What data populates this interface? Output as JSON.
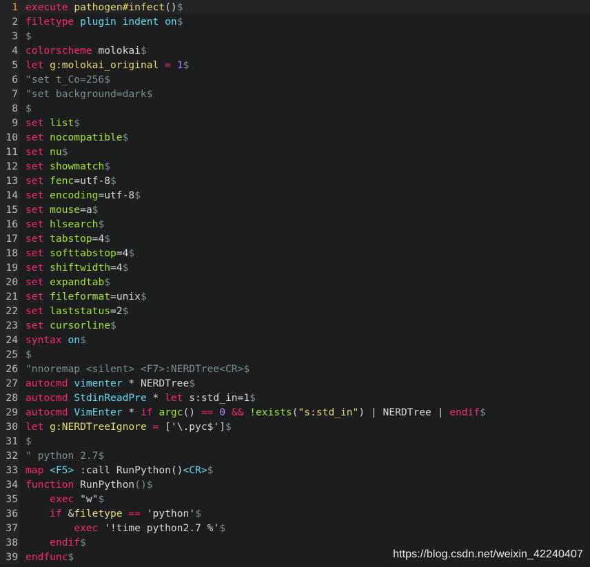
{
  "editor": {
    "current_line": 1,
    "lines": [
      {
        "n": 1,
        "tokens": [
          {
            "t": "execute",
            "c": "stmt"
          },
          {
            "t": " ",
            "c": "plain"
          },
          {
            "t": "pathogen#infect",
            "c": "str"
          },
          {
            "t": "()",
            "c": "plain"
          },
          {
            "t": "$",
            "c": "eol"
          }
        ]
      },
      {
        "n": 2,
        "tokens": [
          {
            "t": "filetype",
            "c": "stmt"
          },
          {
            "t": " ",
            "c": "plain"
          },
          {
            "t": "plugin",
            "c": "type"
          },
          {
            "t": " ",
            "c": "plain"
          },
          {
            "t": "indent",
            "c": "type"
          },
          {
            "t": " ",
            "c": "plain"
          },
          {
            "t": "on",
            "c": "type"
          },
          {
            "t": "$",
            "c": "eol"
          }
        ]
      },
      {
        "n": 3,
        "tokens": [
          {
            "t": "$",
            "c": "eol"
          }
        ]
      },
      {
        "n": 4,
        "tokens": [
          {
            "t": "colorscheme",
            "c": "stmt"
          },
          {
            "t": " molokai",
            "c": "plain"
          },
          {
            "t": "$",
            "c": "eol"
          }
        ]
      },
      {
        "n": 5,
        "tokens": [
          {
            "t": "let",
            "c": "stmt"
          },
          {
            "t": " ",
            "c": "plain"
          },
          {
            "t": "g:molokai_original",
            "c": "str"
          },
          {
            "t": " ",
            "c": "plain"
          },
          {
            "t": "=",
            "c": "op"
          },
          {
            "t": " ",
            "c": "plain"
          },
          {
            "t": "1",
            "c": "num"
          },
          {
            "t": "$",
            "c": "eol"
          }
        ]
      },
      {
        "n": 6,
        "tokens": [
          {
            "t": "\"set t_Co=256",
            "c": "cmt"
          },
          {
            "t": "$",
            "c": "eol"
          }
        ]
      },
      {
        "n": 7,
        "tokens": [
          {
            "t": "\"set background=dark",
            "c": "cmt"
          },
          {
            "t": "$",
            "c": "eol"
          }
        ]
      },
      {
        "n": 8,
        "tokens": [
          {
            "t": "$",
            "c": "eol"
          }
        ]
      },
      {
        "n": 9,
        "tokens": [
          {
            "t": "set",
            "c": "stmt"
          },
          {
            "t": " ",
            "c": "plain"
          },
          {
            "t": "list",
            "c": "fn"
          },
          {
            "t": "$",
            "c": "eol"
          }
        ]
      },
      {
        "n": 10,
        "tokens": [
          {
            "t": "set",
            "c": "stmt"
          },
          {
            "t": " ",
            "c": "plain"
          },
          {
            "t": "nocompatible",
            "c": "fn"
          },
          {
            "t": "$",
            "c": "eol"
          }
        ]
      },
      {
        "n": 11,
        "tokens": [
          {
            "t": "set",
            "c": "stmt"
          },
          {
            "t": " ",
            "c": "plain"
          },
          {
            "t": "nu",
            "c": "fn"
          },
          {
            "t": "$",
            "c": "eol"
          }
        ]
      },
      {
        "n": 12,
        "tokens": [
          {
            "t": "set",
            "c": "stmt"
          },
          {
            "t": " ",
            "c": "plain"
          },
          {
            "t": "showmatch",
            "c": "fn"
          },
          {
            "t": "$",
            "c": "eol"
          }
        ]
      },
      {
        "n": 13,
        "tokens": [
          {
            "t": "set",
            "c": "stmt"
          },
          {
            "t": " ",
            "c": "plain"
          },
          {
            "t": "fenc",
            "c": "fn"
          },
          {
            "t": "=utf-8",
            "c": "plain"
          },
          {
            "t": "$",
            "c": "eol"
          }
        ]
      },
      {
        "n": 14,
        "tokens": [
          {
            "t": "set",
            "c": "stmt"
          },
          {
            "t": " ",
            "c": "plain"
          },
          {
            "t": "encoding",
            "c": "fn"
          },
          {
            "t": "=utf-8",
            "c": "plain"
          },
          {
            "t": "$",
            "c": "eol"
          }
        ]
      },
      {
        "n": 15,
        "tokens": [
          {
            "t": "set",
            "c": "stmt"
          },
          {
            "t": " ",
            "c": "plain"
          },
          {
            "t": "mouse",
            "c": "fn"
          },
          {
            "t": "=a",
            "c": "plain"
          },
          {
            "t": "$",
            "c": "eol"
          }
        ]
      },
      {
        "n": 16,
        "tokens": [
          {
            "t": "set",
            "c": "stmt"
          },
          {
            "t": " ",
            "c": "plain"
          },
          {
            "t": "hlsearch",
            "c": "fn"
          },
          {
            "t": "$",
            "c": "eol"
          }
        ]
      },
      {
        "n": 17,
        "tokens": [
          {
            "t": "set",
            "c": "stmt"
          },
          {
            "t": " ",
            "c": "plain"
          },
          {
            "t": "tabstop",
            "c": "fn"
          },
          {
            "t": "=4",
            "c": "plain"
          },
          {
            "t": "$",
            "c": "eol"
          }
        ]
      },
      {
        "n": 18,
        "tokens": [
          {
            "t": "set",
            "c": "stmt"
          },
          {
            "t": " ",
            "c": "plain"
          },
          {
            "t": "softtabstop",
            "c": "fn"
          },
          {
            "t": "=4",
            "c": "plain"
          },
          {
            "t": "$",
            "c": "eol"
          }
        ]
      },
      {
        "n": 19,
        "tokens": [
          {
            "t": "set",
            "c": "stmt"
          },
          {
            "t": " ",
            "c": "plain"
          },
          {
            "t": "shiftwidth",
            "c": "fn"
          },
          {
            "t": "=4",
            "c": "plain"
          },
          {
            "t": "$",
            "c": "eol"
          }
        ]
      },
      {
        "n": 20,
        "tokens": [
          {
            "t": "set",
            "c": "stmt"
          },
          {
            "t": " ",
            "c": "plain"
          },
          {
            "t": "expandtab",
            "c": "fn"
          },
          {
            "t": "$",
            "c": "eol"
          }
        ]
      },
      {
        "n": 21,
        "tokens": [
          {
            "t": "set",
            "c": "stmt"
          },
          {
            "t": " ",
            "c": "plain"
          },
          {
            "t": "fileformat",
            "c": "fn"
          },
          {
            "t": "=unix",
            "c": "plain"
          },
          {
            "t": "$",
            "c": "eol"
          }
        ]
      },
      {
        "n": 22,
        "tokens": [
          {
            "t": "set",
            "c": "stmt"
          },
          {
            "t": " ",
            "c": "plain"
          },
          {
            "t": "laststatus",
            "c": "fn"
          },
          {
            "t": "=2",
            "c": "plain"
          },
          {
            "t": "$",
            "c": "eol"
          }
        ]
      },
      {
        "n": 23,
        "tokens": [
          {
            "t": "set",
            "c": "stmt"
          },
          {
            "t": " ",
            "c": "plain"
          },
          {
            "t": "cursorline",
            "c": "fn"
          },
          {
            "t": "$",
            "c": "eol"
          }
        ]
      },
      {
        "n": 24,
        "tokens": [
          {
            "t": "syntax",
            "c": "stmt"
          },
          {
            "t": " ",
            "c": "plain"
          },
          {
            "t": "on",
            "c": "type"
          },
          {
            "t": "$",
            "c": "eol"
          }
        ]
      },
      {
        "n": 25,
        "tokens": [
          {
            "t": "$",
            "c": "eol"
          }
        ]
      },
      {
        "n": 26,
        "tokens": [
          {
            "t": "\"nnoremap <silent> <F7>:NERDTree<CR>",
            "c": "cmt"
          },
          {
            "t": "$",
            "c": "eol"
          }
        ]
      },
      {
        "n": 27,
        "tokens": [
          {
            "t": "autocmd",
            "c": "stmt"
          },
          {
            "t": " ",
            "c": "plain"
          },
          {
            "t": "vimenter",
            "c": "type"
          },
          {
            "t": " * NERDTree",
            "c": "plain"
          },
          {
            "t": "$",
            "c": "eol"
          }
        ]
      },
      {
        "n": 28,
        "tokens": [
          {
            "t": "autocmd",
            "c": "stmt"
          },
          {
            "t": " ",
            "c": "plain"
          },
          {
            "t": "StdinReadPre",
            "c": "type"
          },
          {
            "t": " * ",
            "c": "plain"
          },
          {
            "t": "let",
            "c": "stmt"
          },
          {
            "t": " s:std_in=1",
            "c": "plain"
          },
          {
            "t": "$",
            "c": "eol"
          }
        ]
      },
      {
        "n": 29,
        "tokens": [
          {
            "t": "autocmd",
            "c": "stmt"
          },
          {
            "t": " ",
            "c": "plain"
          },
          {
            "t": "VimEnter",
            "c": "type"
          },
          {
            "t": " * ",
            "c": "plain"
          },
          {
            "t": "if",
            "c": "stmt"
          },
          {
            "t": " ",
            "c": "plain"
          },
          {
            "t": "argc",
            "c": "fn"
          },
          {
            "t": "() ",
            "c": "plain"
          },
          {
            "t": "==",
            "c": "op"
          },
          {
            "t": " ",
            "c": "plain"
          },
          {
            "t": "0",
            "c": "num"
          },
          {
            "t": " ",
            "c": "plain"
          },
          {
            "t": "&&",
            "c": "op"
          },
          {
            "t": " ",
            "c": "plain"
          },
          {
            "t": "!exists",
            "c": "fn"
          },
          {
            "t": "(",
            "c": "plain"
          },
          {
            "t": "\"s:std_in\"",
            "c": "str"
          },
          {
            "t": ") | NERDTree | ",
            "c": "plain"
          },
          {
            "t": "endif",
            "c": "stmt"
          },
          {
            "t": "$",
            "c": "eol"
          }
        ]
      },
      {
        "n": 30,
        "tokens": [
          {
            "t": "let",
            "c": "stmt"
          },
          {
            "t": " ",
            "c": "plain"
          },
          {
            "t": "g:NERDTreeIgnore",
            "c": "str"
          },
          {
            "t": " ",
            "c": "plain"
          },
          {
            "t": "=",
            "c": "op"
          },
          {
            "t": " ['\\.pyc$']",
            "c": "plain"
          },
          {
            "t": "$",
            "c": "eol"
          }
        ]
      },
      {
        "n": 31,
        "tokens": [
          {
            "t": "$",
            "c": "eol"
          }
        ]
      },
      {
        "n": 32,
        "tokens": [
          {
            "t": "\" python 2.7",
            "c": "cmt"
          },
          {
            "t": "$",
            "c": "eol"
          }
        ]
      },
      {
        "n": 33,
        "tokens": [
          {
            "t": "map",
            "c": "stmt"
          },
          {
            "t": " ",
            "c": "plain"
          },
          {
            "t": "<F5>",
            "c": "spec"
          },
          {
            "t": " :call RunPython()",
            "c": "plain"
          },
          {
            "t": "<CR>",
            "c": "spec"
          },
          {
            "t": "$",
            "c": "eol"
          }
        ]
      },
      {
        "n": 34,
        "tokens": [
          {
            "t": "function",
            "c": "stmt"
          },
          {
            "t": " RunPython",
            "c": "plain"
          },
          {
            "t": "()",
            "c": "eol"
          },
          {
            "t": "$",
            "c": "eol"
          }
        ]
      },
      {
        "n": 35,
        "tokens": [
          {
            "t": "    ",
            "c": "plain"
          },
          {
            "t": "exec",
            "c": "stmt"
          },
          {
            "t": " \"w\"",
            "c": "plain"
          },
          {
            "t": "$",
            "c": "eol"
          }
        ]
      },
      {
        "n": 36,
        "tokens": [
          {
            "t": "    ",
            "c": "plain"
          },
          {
            "t": "if",
            "c": "stmt"
          },
          {
            "t": " &",
            "c": "plain"
          },
          {
            "t": "filetype",
            "c": "str"
          },
          {
            "t": " ",
            "c": "plain"
          },
          {
            "t": "==",
            "c": "op"
          },
          {
            "t": " 'python'",
            "c": "plain"
          },
          {
            "t": "$",
            "c": "eol"
          }
        ]
      },
      {
        "n": 37,
        "tokens": [
          {
            "t": "        ",
            "c": "plain"
          },
          {
            "t": "exec",
            "c": "stmt"
          },
          {
            "t": " '!time python2.7 %'",
            "c": "plain"
          },
          {
            "t": "$",
            "c": "eol"
          }
        ]
      },
      {
        "n": 38,
        "tokens": [
          {
            "t": "    ",
            "c": "plain"
          },
          {
            "t": "endif",
            "c": "stmt"
          },
          {
            "t": "$",
            "c": "eol"
          }
        ]
      },
      {
        "n": 39,
        "tokens": [
          {
            "t": "endfunc",
            "c": "stmt"
          },
          {
            "t": "$",
            "c": "eol"
          }
        ]
      }
    ]
  },
  "watermark": "https://blog.csdn.net/weixin_42240407",
  "colors": {
    "background": "#1b1d1e",
    "gutter": "#232526",
    "line_number": "#bcbcbc",
    "current_line_number": "#fd971f",
    "statement": "#f92672",
    "function": "#a6e22e",
    "type": "#66d9ef",
    "number": "#ae81ff",
    "string": "#e6db74",
    "comment": "#7e8e91"
  }
}
